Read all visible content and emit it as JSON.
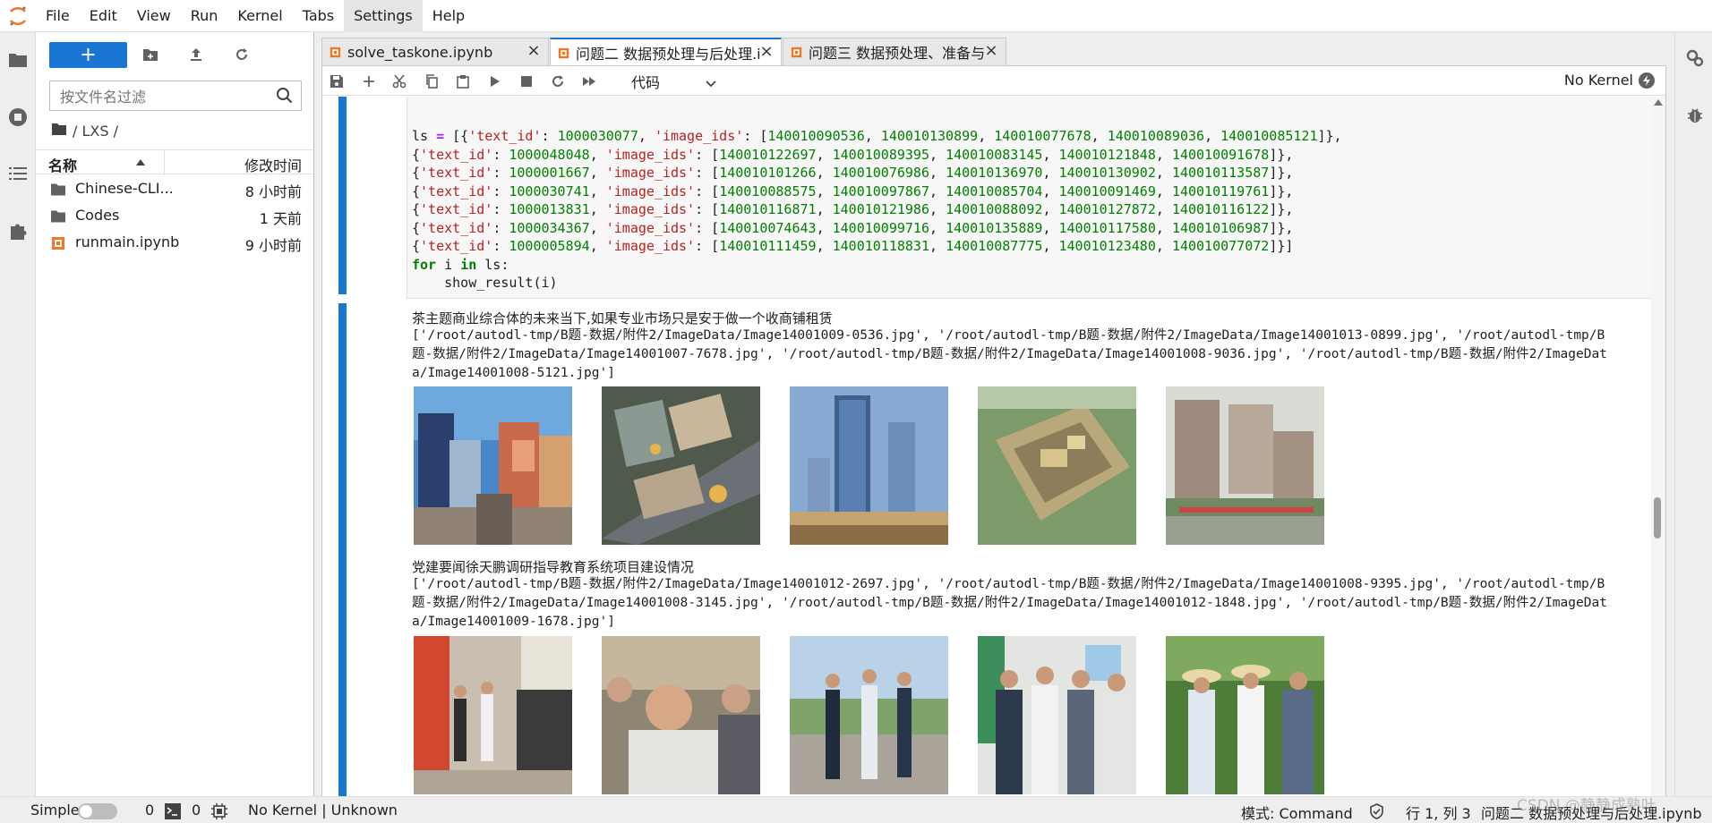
{
  "menu": {
    "items": [
      "File",
      "Edit",
      "View",
      "Run",
      "Kernel",
      "Tabs",
      "Settings",
      "Help"
    ],
    "active": "Settings"
  },
  "filebrowser": {
    "search_placeholder": "按文件名过滤",
    "breadcrumb": "/ LXS /",
    "col_name": "名称",
    "col_modified": "修改时间",
    "files": [
      {
        "name": "Chinese-CLI...",
        "modified": "8 小时前",
        "type": "folder"
      },
      {
        "name": "Codes",
        "modified": "1 天前",
        "type": "folder"
      },
      {
        "name": "runmain.ipynb",
        "modified": "9 小时前",
        "type": "notebook"
      }
    ]
  },
  "tabs": [
    {
      "label": "solve_taskone.ipynb"
    },
    {
      "label": "问题二 数据预处理与后处理.i"
    },
    {
      "label": "问题三 数据预处理、准备与"
    }
  ],
  "toolbar": {
    "cell_type": "代码",
    "kernel": "No Kernel"
  },
  "code": {
    "lines": [
      {
        "parts": [
          [
            "var",
            "ls "
          ],
          [
            "op",
            "="
          ],
          [
            "var",
            " [{"
          ],
          [
            "str",
            "'text_id'"
          ],
          [
            "var",
            ": "
          ],
          [
            "num",
            "1000030077"
          ],
          [
            "var",
            ", "
          ],
          [
            "str",
            "'image_ids'"
          ],
          [
            "var",
            ": ["
          ],
          [
            "num",
            "140010090536"
          ],
          [
            "var",
            ", "
          ],
          [
            "num",
            "140010130899"
          ],
          [
            "var",
            ", "
          ],
          [
            "num",
            "140010077678"
          ],
          [
            "var",
            ", "
          ],
          [
            "num",
            "140010089036"
          ],
          [
            "var",
            ", "
          ],
          [
            "num",
            "140010085121"
          ],
          [
            "var",
            "]},"
          ]
        ]
      },
      {
        "parts": [
          [
            "var",
            "{"
          ],
          [
            "str",
            "'text_id'"
          ],
          [
            "var",
            ": "
          ],
          [
            "num",
            "1000048048"
          ],
          [
            "var",
            ", "
          ],
          [
            "str",
            "'image_ids'"
          ],
          [
            "var",
            ": ["
          ],
          [
            "num",
            "140010122697"
          ],
          [
            "var",
            ", "
          ],
          [
            "num",
            "140010089395"
          ],
          [
            "var",
            ", "
          ],
          [
            "num",
            "140010083145"
          ],
          [
            "var",
            ", "
          ],
          [
            "num",
            "140010121848"
          ],
          [
            "var",
            ", "
          ],
          [
            "num",
            "140010091678"
          ],
          [
            "var",
            "]},"
          ]
        ]
      },
      {
        "parts": [
          [
            "var",
            "{"
          ],
          [
            "str",
            "'text_id'"
          ],
          [
            "var",
            ": "
          ],
          [
            "num",
            "1000001667"
          ],
          [
            "var",
            ", "
          ],
          [
            "str",
            "'image_ids'"
          ],
          [
            "var",
            ": ["
          ],
          [
            "num",
            "140010101266"
          ],
          [
            "var",
            ", "
          ],
          [
            "num",
            "140010076986"
          ],
          [
            "var",
            ", "
          ],
          [
            "num",
            "140010136970"
          ],
          [
            "var",
            ", "
          ],
          [
            "num",
            "140010130902"
          ],
          [
            "var",
            ", "
          ],
          [
            "num",
            "140010113587"
          ],
          [
            "var",
            "]},"
          ]
        ]
      },
      {
        "parts": [
          [
            "var",
            "{"
          ],
          [
            "str",
            "'text_id'"
          ],
          [
            "var",
            ": "
          ],
          [
            "num",
            "1000030741"
          ],
          [
            "var",
            ", "
          ],
          [
            "str",
            "'image_ids'"
          ],
          [
            "var",
            ": ["
          ],
          [
            "num",
            "140010088575"
          ],
          [
            "var",
            ", "
          ],
          [
            "num",
            "140010097867"
          ],
          [
            "var",
            ", "
          ],
          [
            "num",
            "140010085704"
          ],
          [
            "var",
            ", "
          ],
          [
            "num",
            "140010091469"
          ],
          [
            "var",
            ", "
          ],
          [
            "num",
            "140010119761"
          ],
          [
            "var",
            "]},"
          ]
        ]
      },
      {
        "parts": [
          [
            "var",
            "{"
          ],
          [
            "str",
            "'text_id'"
          ],
          [
            "var",
            ": "
          ],
          [
            "num",
            "1000013831"
          ],
          [
            "var",
            ", "
          ],
          [
            "str",
            "'image_ids'"
          ],
          [
            "var",
            ": ["
          ],
          [
            "num",
            "140010116871"
          ],
          [
            "var",
            ", "
          ],
          [
            "num",
            "140010121986"
          ],
          [
            "var",
            ", "
          ],
          [
            "num",
            "140010088092"
          ],
          [
            "var",
            ", "
          ],
          [
            "num",
            "140010127872"
          ],
          [
            "var",
            ", "
          ],
          [
            "num",
            "140010116122"
          ],
          [
            "var",
            "]},"
          ]
        ]
      },
      {
        "parts": [
          [
            "var",
            "{"
          ],
          [
            "str",
            "'text_id'"
          ],
          [
            "var",
            ": "
          ],
          [
            "num",
            "1000034367"
          ],
          [
            "var",
            ", "
          ],
          [
            "str",
            "'image_ids'"
          ],
          [
            "var",
            ": ["
          ],
          [
            "num",
            "140010074643"
          ],
          [
            "var",
            ", "
          ],
          [
            "num",
            "140010099716"
          ],
          [
            "var",
            ", "
          ],
          [
            "num",
            "140010135889"
          ],
          [
            "var",
            ", "
          ],
          [
            "num",
            "140010117580"
          ],
          [
            "var",
            ", "
          ],
          [
            "num",
            "140010106987"
          ],
          [
            "var",
            "]},"
          ]
        ]
      },
      {
        "parts": [
          [
            "var",
            "{"
          ],
          [
            "str",
            "'text_id'"
          ],
          [
            "var",
            ": "
          ],
          [
            "num",
            "1000005894"
          ],
          [
            "var",
            ", "
          ],
          [
            "str",
            "'image_ids'"
          ],
          [
            "var",
            ": ["
          ],
          [
            "num",
            "140010111459"
          ],
          [
            "var",
            ", "
          ],
          [
            "num",
            "140010118831"
          ],
          [
            "var",
            ", "
          ],
          [
            "num",
            "140010087775"
          ],
          [
            "var",
            ", "
          ],
          [
            "num",
            "140010123480"
          ],
          [
            "var",
            ", "
          ],
          [
            "num",
            "140010077072"
          ],
          [
            "var",
            "]}]"
          ]
        ]
      },
      {
        "parts": [
          [
            "kw",
            "for"
          ],
          [
            "var",
            " i "
          ],
          [
            "kw",
            "in"
          ],
          [
            "var",
            " ls:"
          ]
        ]
      },
      {
        "parts": [
          [
            "var",
            "    show_result(i)"
          ]
        ]
      }
    ]
  },
  "outputs": [
    {
      "title": "茶主题商业综合体的未来当下,如果专业市场只是安于做一个收商铺租赁",
      "paths": [
        "['/root/autodl-tmp/B题-数据/附件2/ImageData/Image14001009-0536.jpg', '/root/autodl-tmp/B题-数据/附件2/ImageData/Image14001013-0899.jpg', '/root/autodl-tmp/B",
        "题-数据/附件2/ImageData/Image14001007-7678.jpg', '/root/autodl-tmp/B题-数据/附件2/ImageData/Image14001008-9036.jpg', '/root/autodl-tmp/B题-数据/附件2/ImageDat",
        "a/Image14001008-5121.jpg']"
      ],
      "thumbnails": [
        "street-buildings-image",
        "aerial-complex-image",
        "towers-image",
        "aerial-model-image",
        "building-model-image"
      ]
    },
    {
      "title": "党建要闻徐天鹏调研指导教育系统项目建设情况",
      "paths": [
        "['/root/autodl-tmp/B题-数据/附件2/ImageData/Image14001012-2697.jpg', '/root/autodl-tmp/B题-数据/附件2/ImageData/Image14001008-9395.jpg', '/root/autodl-tmp/B",
        "题-数据/附件2/ImageData/Image14001008-3145.jpg', '/root/autodl-tmp/B题-数据/附件2/ImageData/Image14001012-1848.jpg', '/root/autodl-tmp/B题-数据/附件2/ImageDat",
        "a/Image14001009-1678.jpg']"
      ],
      "thumbnails": [
        "corridor-people-image",
        "meeting-image",
        "site-visit-image",
        "classroom-people-image",
        "field-inspection-image"
      ]
    }
  ],
  "statusbar": {
    "mode_label": "Simple",
    "terminals": "0",
    "kernels": "0",
    "kernel_status": "No Kernel | Unknown",
    "command_mode": "模式: Command",
    "cursor": "行 1, 列 3",
    "doc_name": "问题二 数据预处理与后处理.ipynb"
  },
  "watermark": "CSDN @静静成熟叶",
  "colors": {
    "accent": "#1976d2",
    "notebook_icon": "#f37626",
    "string": "#ba2121",
    "number": "#008000",
    "keyword": "#008000",
    "operator": "#aa22ff"
  }
}
